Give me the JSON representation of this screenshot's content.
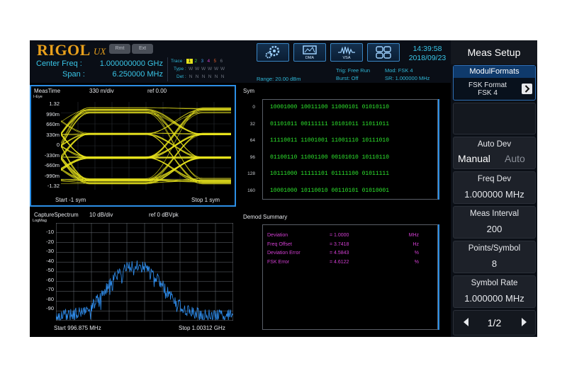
{
  "brand": {
    "logo": "RIGOL",
    "logo_suffix": "UX"
  },
  "header": {
    "rmt": "Rmt",
    "ext": "Ext",
    "center_freq_label": "Center Freq :",
    "center_freq_value": "1.000000000 GHz",
    "span_label": "Span :",
    "span_value": "6.250000 MHz",
    "trace_label": "Trace :",
    "trace_numbers": [
      "1",
      "2",
      "3",
      "4",
      "5",
      "6"
    ],
    "trace_colors": [
      "#e6e21c",
      "#3bd53b",
      "#3fa0f0",
      "#d33fd3",
      "#e05a2a",
      "#6e7480"
    ],
    "type_label": "Type :",
    "type_values": [
      "W",
      "W",
      "W",
      "W",
      "W",
      "W"
    ],
    "det_label": "Det :",
    "det_values": [
      "N",
      "N",
      "N",
      "N",
      "N",
      "N"
    ],
    "range": "Range: 20.00 dBm",
    "trig": "Trig: Free Run",
    "burst": "Burst: Off",
    "mod": "Mod: FSK 4",
    "sr": "SR: 1.000000 MHz",
    "mode_buttons": [
      "",
      "DMA",
      "VSA",
      ""
    ],
    "time": "14:39:58",
    "date": "2018/09/23"
  },
  "softkeys": {
    "title": "Meas Setup",
    "modul_formats": {
      "title": "ModulFormats",
      "line1": "FSK Format",
      "line2": "FSK 4"
    },
    "auto_dev": {
      "title": "Auto Dev",
      "opt_manual": "Manual",
      "opt_auto": "Auto"
    },
    "freq_dev": {
      "title": "Freq Dev",
      "value": "1.000000 MHz"
    },
    "meas_interval": {
      "title": "Meas Interval",
      "value": "200"
    },
    "points_symbol": {
      "title": "Points/Symbol",
      "value": "8"
    },
    "symbol_rate": {
      "title": "Symbol Rate",
      "value": "1.000000 MHz"
    },
    "page": "1/2"
  },
  "eye": {
    "title": "MeasTime",
    "scale": "330 m/div",
    "ref": "ref 0.00",
    "corner": "I-Eye",
    "y_labels": [
      "1.32",
      "990m",
      "660m",
      "330m",
      "0",
      "-330m",
      "-660m",
      "-990m",
      "-1.32"
    ],
    "start": "Start -1 sym",
    "stop": "Stop 1 sym"
  },
  "sym": {
    "title": "Sym",
    "indices": [
      "0",
      "32",
      "64",
      "96",
      "128",
      "160"
    ],
    "rows": [
      "10001000  10011100  11000101  01010110",
      "01101011  00111111  10101011  11011011",
      "11110011  11001001  11001110  10111010",
      "01100110  11001100  00101010  10110110",
      "10111000  11111101  01111100  01011111",
      "10001000  10110010  00110101  01010001"
    ]
  },
  "spectrum": {
    "title": "CaptureSpectrum",
    "scale": "10 dB/div",
    "ref": "ref 0 dBVpk",
    "corner": "LogMag",
    "y_labels": [
      "-10",
      "-20",
      "-30",
      "-40",
      "-50",
      "-60",
      "-70",
      "-80",
      "-90"
    ],
    "start": "Start 996.875 MHz",
    "stop": "Stop 1.00312 GHz"
  },
  "demod": {
    "title": "Demod Summary",
    "rows": [
      {
        "name": "Deviation",
        "value": "= 1.0000",
        "unit": "MHz"
      },
      {
        "name": "Freq Offset",
        "value": "= 3.7418",
        "unit": "Hz"
      },
      {
        "name": "Deviation Error",
        "value": "= 4.5843",
        "unit": "%"
      },
      {
        "name": "FSK Error",
        "value": "= 4.6122",
        "unit": "%"
      }
    ]
  },
  "colors": {
    "eye_trace": "#e6e21c",
    "spectrum_trace": "#2f8ff0",
    "sym_text": "#2ee62e",
    "demod_text": "#d33fd3",
    "accent": "#39c6e8"
  }
}
